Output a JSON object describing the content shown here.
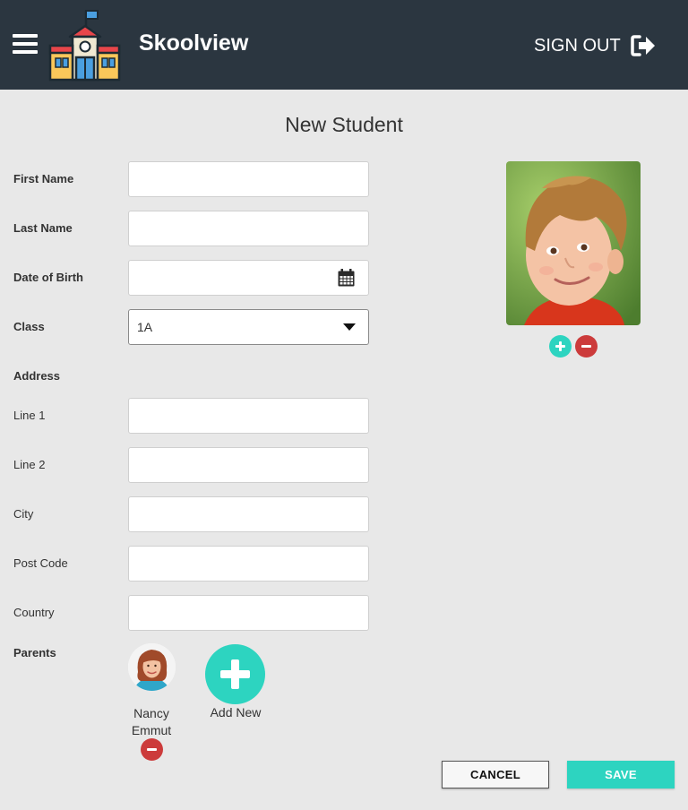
{
  "header": {
    "app_title": "Skoolview",
    "sign_out_label": "SIGN OUT",
    "background_color": "#2b3640"
  },
  "page": {
    "title": "New Student"
  },
  "form": {
    "first_name": {
      "label": "First Name",
      "value": ""
    },
    "last_name": {
      "label": "Last Name",
      "value": ""
    },
    "date_of_birth": {
      "label": "Date of Birth",
      "value": ""
    },
    "class": {
      "label": "Class",
      "selected": "1A"
    },
    "address": {
      "section_label": "Address",
      "line1": {
        "label": "Line 1",
        "value": ""
      },
      "line2": {
        "label": "Line 2",
        "value": ""
      },
      "city": {
        "label": "City",
        "value": ""
      },
      "post_code": {
        "label": "Post Code",
        "value": ""
      },
      "country": {
        "label": "Country",
        "value": ""
      }
    },
    "parents": {
      "section_label": "Parents",
      "items": [
        {
          "name": "Nancy Emmut"
        }
      ],
      "add_new_label": "Add New"
    }
  },
  "actions": {
    "cancel_label": "CANCEL",
    "save_label": "SAVE"
  },
  "colors": {
    "accent": "#2dd4c0",
    "danger": "#cc3b3b"
  }
}
